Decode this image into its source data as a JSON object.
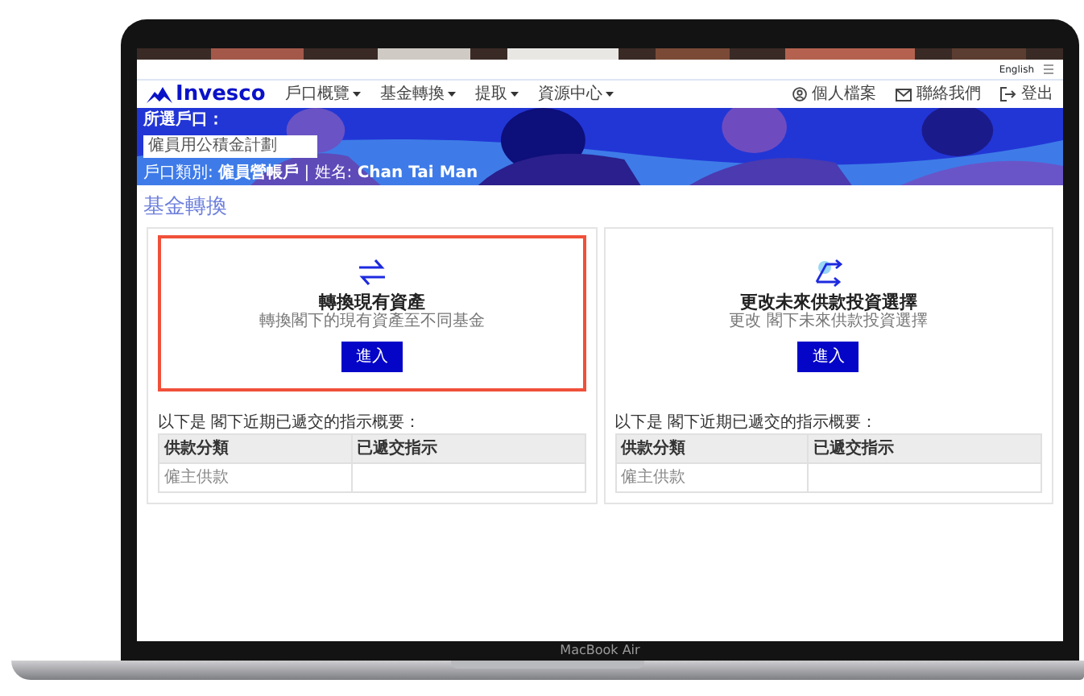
{
  "device": {
    "label": "MacBook Air"
  },
  "top_bar": {
    "language": "English"
  },
  "nav": {
    "logo": "Invesco",
    "menu": [
      {
        "label": "戶口概覽",
        "dropdown": true
      },
      {
        "label": "基金轉換",
        "dropdown": true
      },
      {
        "label": "提取",
        "dropdown": true
      },
      {
        "label": "資源中心",
        "dropdown": true
      }
    ],
    "actions": [
      {
        "kind": "profile",
        "label": "個人檔案"
      },
      {
        "kind": "mail",
        "label": "聯絡我們"
      },
      {
        "kind": "logout",
        "label": "登出"
      }
    ]
  },
  "banner": {
    "account_label": "所選戶口：",
    "account_value": "僱員用公積金計劃",
    "info": "戶口類別: **僱員營帳戶** | 姓名: **Chan Tai Man**"
  },
  "page_title": "基金轉換",
  "cards": [
    {
      "kind": "swap",
      "title": "轉換現有資產",
      "subtitle": "轉換閣下的現有資產至不同基金",
      "button": "進入",
      "highlighted": true,
      "summary_title": "以下是 閣下近期已遞交的指示概要：",
      "columns": [
        "供款分類",
        "已遞交指示"
      ],
      "rows": [
        {
          "category": "僱主供款"
        }
      ]
    },
    {
      "kind": "redirect",
      "title": "更改未來供款投資選擇",
      "subtitle": "更改 閣下未來供款投資選擇",
      "button": "進入",
      "highlighted": false,
      "summary_title": "以下是 閣下近期已遞交的指示概要：",
      "columns": [
        "供款分類",
        "已遞交指示"
      ],
      "rows": [
        {
          "category": "僱主供款"
        }
      ]
    }
  ]
}
